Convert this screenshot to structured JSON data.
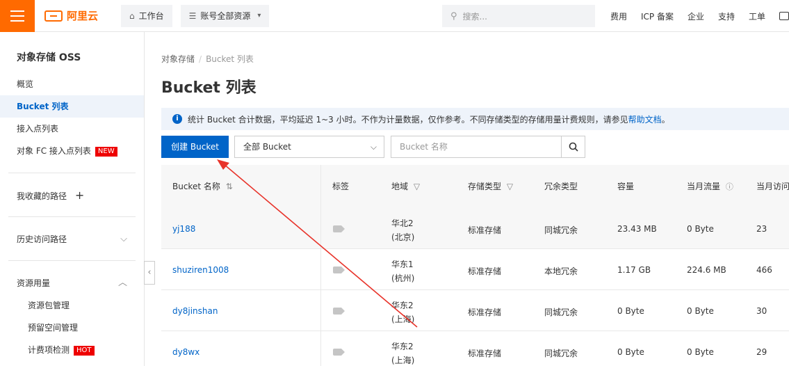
{
  "topbar": {
    "logo_text": "阿里云",
    "workbench": "工作台",
    "resources": "账号全部资源",
    "search_placeholder": "搜索...",
    "links": [
      "费用",
      "ICP 备案",
      "企业",
      "支持",
      "工单"
    ]
  },
  "sidebar": {
    "title": "对象存储 OSS",
    "items": [
      {
        "label": "概览"
      },
      {
        "label": "Bucket 列表"
      },
      {
        "label": "接入点列表"
      },
      {
        "label": "对象 FC 接入点列表",
        "badge": "NEW"
      }
    ],
    "favorites": "我收藏的路径",
    "history": "历史访问路径",
    "usage": "资源用量",
    "usage_items": [
      {
        "label": "资源包管理"
      },
      {
        "label": "预留空间管理"
      },
      {
        "label": "计费项检测",
        "badge": "HOT"
      }
    ]
  },
  "breadcrumb": {
    "root": "对象存储",
    "current": "Bucket 列表"
  },
  "page_title": "Bucket 列表",
  "info": {
    "text": "统计 Bucket 合计数据，平均延迟 1~3 小时。不作为计量数据，仅作参考。不同存储类型的存储用量计费规则，请参见",
    "link": "帮助文档",
    "tail": "。"
  },
  "toolbar": {
    "create": "创建 Bucket",
    "filter_value": "全部 Bucket",
    "search_placeholder": "Bucket 名称"
  },
  "table": {
    "headers": [
      "Bucket 名称",
      "标签",
      "地域",
      "存储类型",
      "冗余类型",
      "容量",
      "当月流量",
      "当月访问"
    ],
    "rows": [
      {
        "name": "yj188",
        "region1": "华北2",
        "region2": "(北京)",
        "storage": "标准存储",
        "redundancy": "同城冗余",
        "capacity": "23.43 MB",
        "traffic": "0 Byte",
        "visits": "23"
      },
      {
        "name": "shuziren1008",
        "region1": "华东1",
        "region2": "(杭州)",
        "storage": "标准存储",
        "redundancy": "本地冗余",
        "capacity": "1.17 GB",
        "traffic": "224.6 MB",
        "visits": "466"
      },
      {
        "name": "dy8jinshan",
        "region1": "华东2",
        "region2": "(上海)",
        "storage": "标准存储",
        "redundancy": "同城冗余",
        "capacity": "0 Byte",
        "traffic": "0 Byte",
        "visits": "30"
      },
      {
        "name": "dy8wx",
        "region1": "华东2",
        "region2": "(上海)",
        "storage": "标准存储",
        "redundancy": "同城冗余",
        "capacity": "0 Byte",
        "traffic": "0 Byte",
        "visits": "29"
      }
    ]
  },
  "colors": {
    "brand": "#ff6a00",
    "primary": "#0064c8",
    "arrow": "#e8332a"
  }
}
